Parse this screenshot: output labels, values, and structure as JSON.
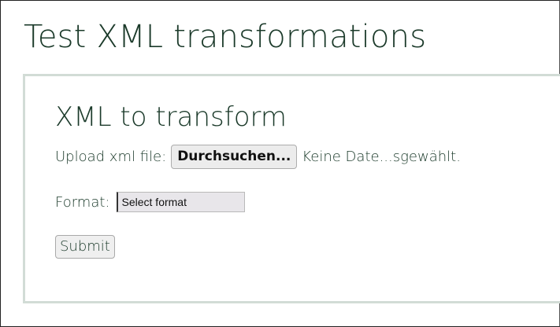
{
  "header": {
    "title": "Test XML transformations"
  },
  "form": {
    "section_title": "XML to transform",
    "upload_label": "Upload xml file:",
    "browse_button_label": "Durchsuchen...",
    "file_status": "Keine Date...sgewählt.",
    "format_label": "Format:",
    "format_select_value": "Select format",
    "submit_label": "Submit"
  }
}
